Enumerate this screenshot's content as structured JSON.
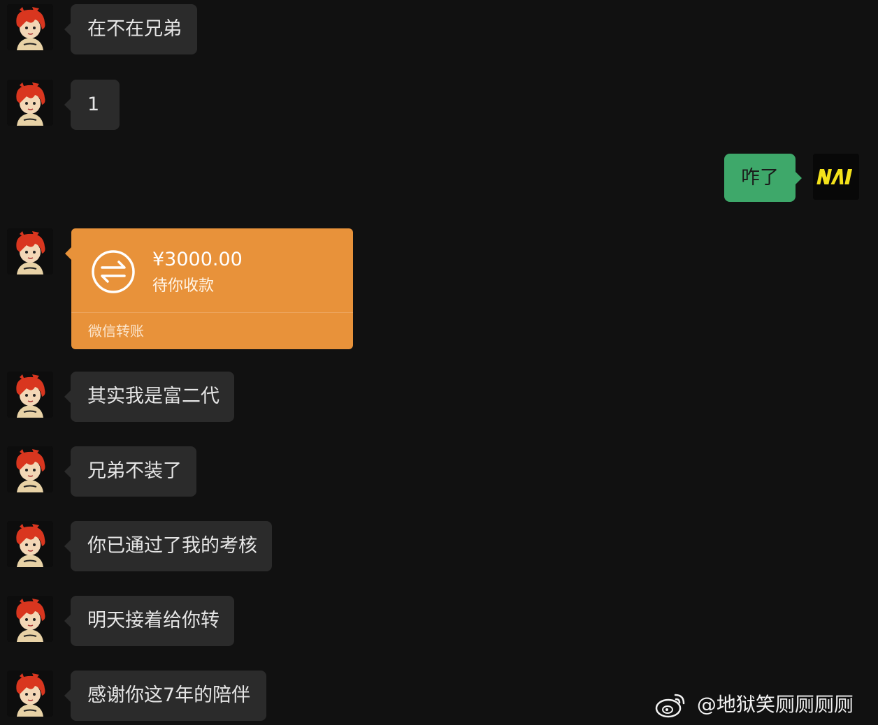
{
  "messages": [
    {
      "text": "在不在兄弟"
    },
    {
      "text": "1"
    },
    {
      "text": "其实我是富二代"
    },
    {
      "text": "兄弟不装了"
    },
    {
      "text": "你已通过了我的考核"
    },
    {
      "text": "明天接着给你转"
    },
    {
      "text": "感谢你这7年的陪伴"
    }
  ],
  "my_message": {
    "text": "咋了"
  },
  "transfer": {
    "amount": "¥3000.00",
    "status": "待你收款",
    "label": "微信转账"
  },
  "my_avatar_logo": "NAVI",
  "watermark": {
    "text": "@地狱笑厕厕厕厕",
    "icon": "weibo-icon"
  },
  "colors": {
    "background": "#111111",
    "incoming_bubble": "#2b2b2b",
    "outgoing_bubble": "#3ea86a",
    "transfer_card": "#e8923a",
    "navi_yellow": "#f4e21b"
  }
}
